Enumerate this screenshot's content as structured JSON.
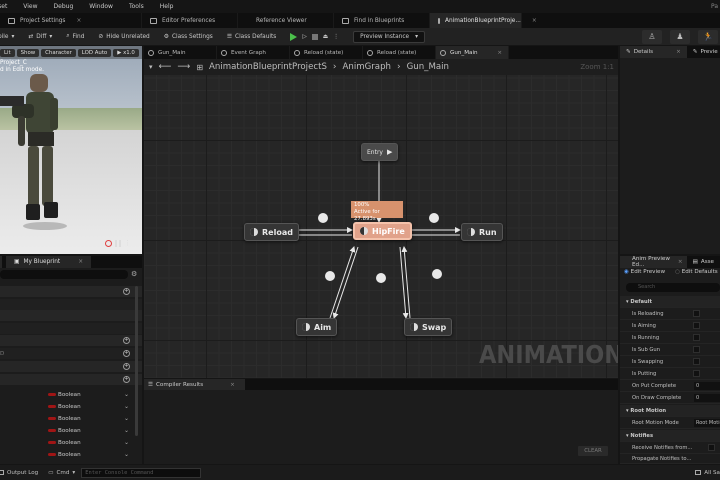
{
  "menu": [
    "sset",
    "View",
    "Debug",
    "Window",
    "Tools",
    "Help"
  ],
  "menu_right": "Pa",
  "top_tabs": [
    {
      "label": "Project Settings",
      "active": false
    },
    {
      "label": "Editor Preferences",
      "active": false
    },
    {
      "label": "Reference Viewer",
      "active": false
    },
    {
      "label": "Find in Blueprints",
      "active": false
    },
    {
      "label": "AnimationBlueprintProje...",
      "active": true
    }
  ],
  "toolbar": {
    "compile": "pile",
    "diff": "Diff",
    "find": "Find",
    "hide_unrelated": "Hide Unrelated",
    "class_settings": "Class Settings",
    "class_defaults": "Class Defaults",
    "preview_instance": "Preview Instance"
  },
  "viewport": {
    "buttons": [
      "Lit",
      "Show",
      "Character",
      "LOD Auto",
      "x1.0"
    ],
    "overlay_line1": "Project_C",
    "overlay_line2": "d in Edit mode."
  },
  "my_blueprint": {
    "tab": "My Blueprint",
    "variables": [
      "Boolean",
      "Boolean",
      "Boolean",
      "Boolean",
      "Boolean",
      "Boolean"
    ],
    "row_label": "D"
  },
  "graph_tabs": [
    {
      "label": "Gun_Main",
      "active": false
    },
    {
      "label": "Event Graph",
      "active": false
    },
    {
      "label": "Reload (state)",
      "active": false
    },
    {
      "label": "Reload (state)",
      "active": false
    },
    {
      "label": "Gun_Main",
      "active": true
    }
  ],
  "breadcrumb": [
    "AnimationBlueprintProjectS",
    "AnimGraph",
    "Gun_Main"
  ],
  "zoom": "Zoom 1:1",
  "graph": {
    "entry": "Entry",
    "nodes": {
      "reload": "Reload",
      "hipfire": "HipFire",
      "run": "Run",
      "aim": "Aim",
      "swap": "Swap"
    },
    "active_line1": "100%",
    "active_line2": "Active for 27.893s",
    "watermark": "ANIMATION"
  },
  "compiler": {
    "tab": "Compiler Results",
    "clear": "CLEAR"
  },
  "details": {
    "tab": "Details",
    "tab2": "Previe"
  },
  "anim_preview": {
    "tab": "Anim Preview Ed...",
    "tab2": "Asse",
    "edit_preview": "Edit Preview",
    "edit_defaults": "Edit Defaults",
    "search_placeholder": "Search",
    "section_default": "Default",
    "rows": [
      "Is Reloading",
      "Is Aiming",
      "Is Running",
      "Is Sub Gun",
      "Is Swapping",
      "Is Putting"
    ],
    "put_complete": "On Put Complete",
    "draw_complete": "On Draw Complete",
    "value_zero": "0",
    "section_root": "Root Motion",
    "root_motion_mode": "Root Motion Mode",
    "root_motion_value": "Root Motio",
    "section_notifies": "Notifies",
    "receive_notifies": "Receive Notifies from...",
    "propagate_notifies": "Propagate Notifies to..."
  },
  "status": {
    "output_log": "Output Log",
    "cmd": "Cmd",
    "console_placeholder": "Enter Console Command",
    "right": "All Sa"
  }
}
